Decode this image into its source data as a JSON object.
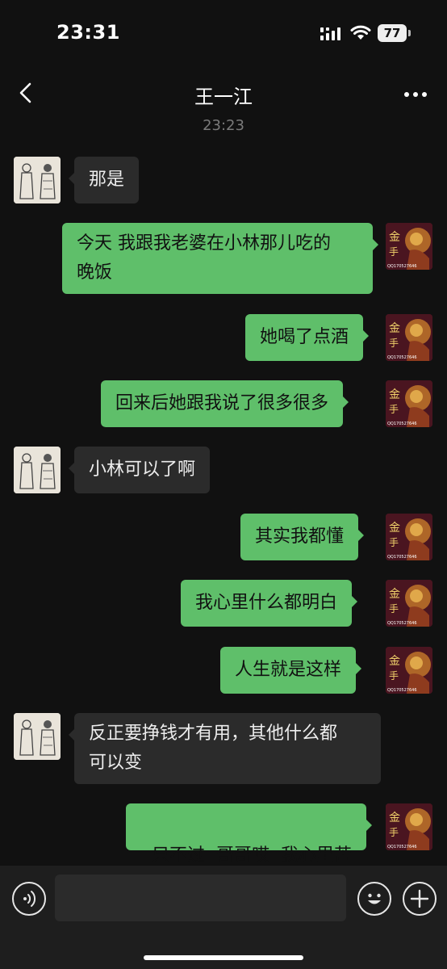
{
  "status_bar": {
    "time": "23:31",
    "battery": "77"
  },
  "nav": {
    "title": "王一江"
  },
  "timestamp": "23:23",
  "messages": [
    {
      "side": "in",
      "text": "那是"
    },
    {
      "side": "out",
      "line1": "今天 我跟我老婆在小林那儿吃的",
      "line2": "晚饭"
    },
    {
      "side": "out",
      "text": "她喝了点酒"
    },
    {
      "side": "out",
      "text": "回来后她跟我说了很多很多"
    },
    {
      "side": "in",
      "text": "小林可以了啊"
    },
    {
      "side": "out",
      "text": "其实我都懂"
    },
    {
      "side": "out",
      "text": "我心里什么都明白"
    },
    {
      "side": "out",
      "text": "人生就是这样"
    },
    {
      "side": "in",
      "line1": "反正要挣钱才有用，其他什么都",
      "line2": "可以变"
    },
    {
      "side": "out",
      "text": "只不过  哥哥哎  我心里苦"
    }
  ],
  "avatar_right_text": "QQ170527646",
  "avatar_right_glyphs": "金手",
  "input": {
    "value": ""
  }
}
